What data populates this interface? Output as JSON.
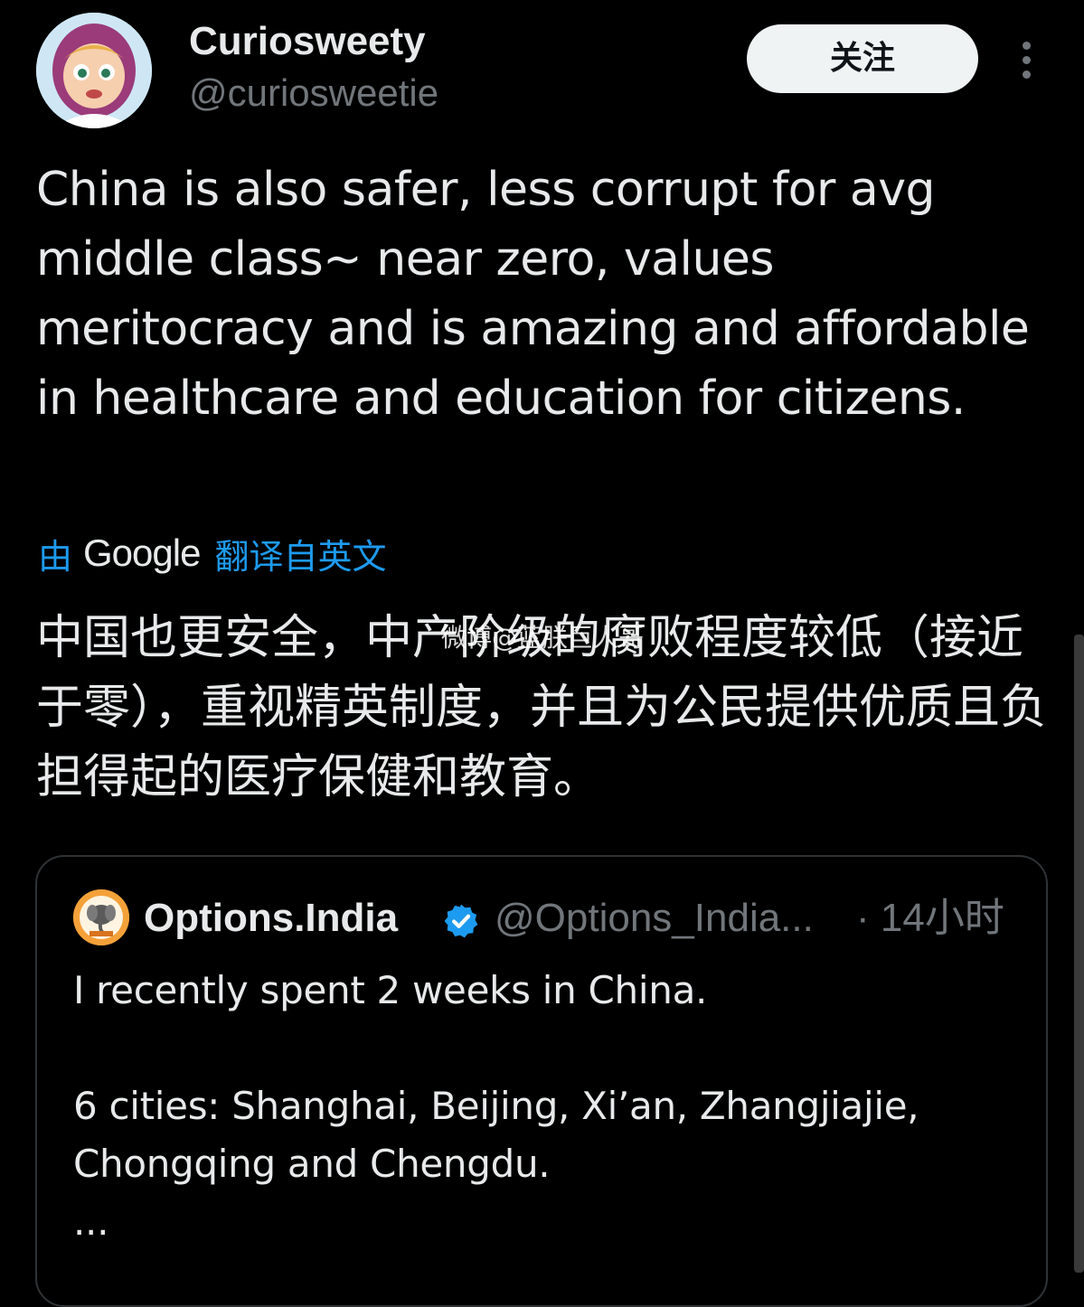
{
  "author": {
    "display_name": "Curiosweety",
    "handle": "@curiosweetie",
    "avatar_icon": "cartoon-girl-avatar"
  },
  "header": {
    "follow_label": "关注",
    "more_icon": "vertical-ellipsis-icon"
  },
  "tweet": {
    "text": "China is also safer, less corrupt for avg middle class~ near zero, values meritocracy and is amazing and affordable in healthcare and education for citizens."
  },
  "translation": {
    "by_label": "由",
    "provider": "Google",
    "label": "翻译自英文",
    "text": "中国也更安全，中产阶级的腐败程度较低（接近于零），重视精英制度，并且为公民提供优质且负担得起的医疗保健和教育。",
    "watermark": "微博@蓝朕巨人哥"
  },
  "quote": {
    "display_name": "Options.India",
    "handle": "@Options_India...",
    "time": "· 14小时",
    "avatar_icon": "ganesha-logo-avatar",
    "verified_icon": "verified-badge-icon",
    "lines": [
      "I recently spent 2 weeks in China.",
      "6 cities: Shanghai, Beijing, Xi’an, Zhangjiajie, Chongqing and Chengdu.",
      "..."
    ]
  },
  "colors": {
    "background": "#000000",
    "text_primary": "#e7e9ea",
    "text_secondary": "#71767b",
    "link_blue": "#1d9bf0",
    "verified_blue": "#1d9bf0",
    "border": "#2f3336",
    "follow_bg": "#eff3f4"
  }
}
